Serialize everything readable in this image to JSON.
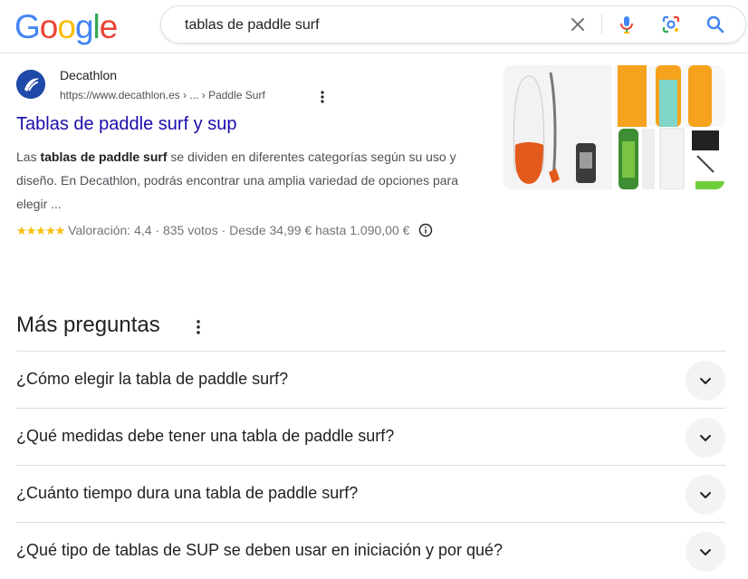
{
  "logo": {
    "letters": [
      "G",
      "o",
      "o",
      "g",
      "l",
      "e"
    ],
    "colors": [
      "#4285F4",
      "#EA4335",
      "#FBBC05",
      "#4285F4",
      "#34A853",
      "#EA4335"
    ]
  },
  "search": {
    "query": "tablas de paddle surf"
  },
  "result": {
    "site_name": "Decathlon",
    "url": "https://www.decathlon.es › ... › Paddle Surf",
    "title": "Tablas de paddle surf y sup",
    "snippet": {
      "before": "Las ",
      "bold": "tablas de paddle surf",
      "after": " se dividen en diferentes categorías según su uso y diseño. En Decathlon, podrás encontrar una amplia variedad de opciones para elegir ..."
    },
    "rating": {
      "stars": "★★★★★",
      "label": "Valoración: 4,4",
      "sep1": "·",
      "votes": "835 votos",
      "sep2": "·",
      "price": "Desde 34,99 € hasta 1.090,00 €"
    }
  },
  "more_questions": {
    "title": "Más preguntas",
    "items": [
      "¿Cómo elegir la tabla de paddle surf?",
      "¿Qué medidas debe tener una tabla de paddle surf?",
      "¿Cuánto tiempo dura una tabla de paddle surf?",
      "¿Qué tipo de tablas de SUP se deben usar en iniciación y por qué?"
    ]
  },
  "colors": {
    "link": "#1a0dab",
    "star": "#fbbc04",
    "brand_blue": "#1f4aa8"
  }
}
